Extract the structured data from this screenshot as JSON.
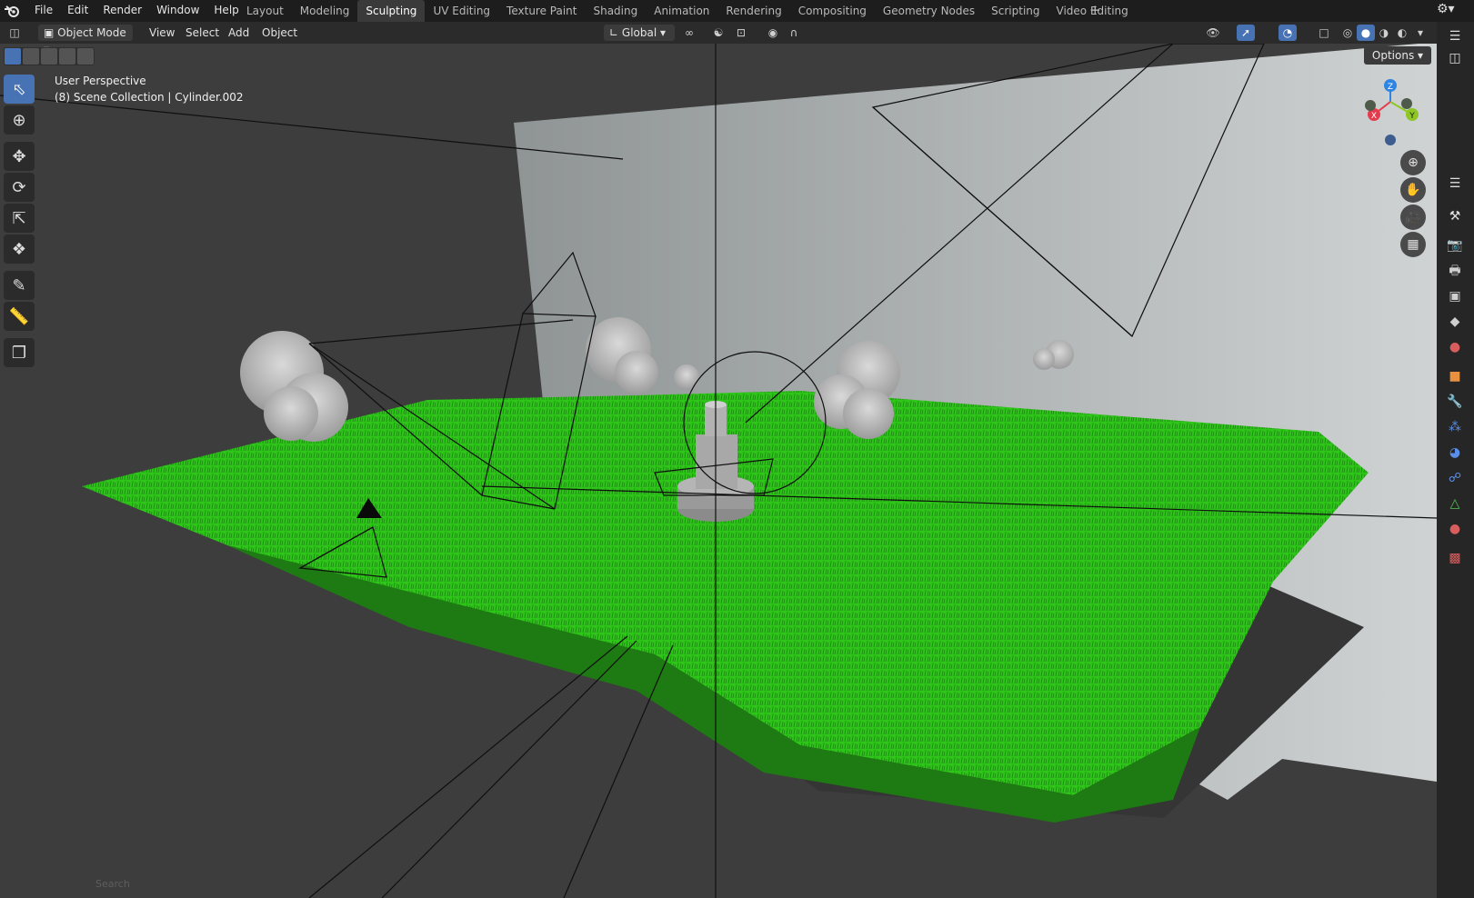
{
  "menubar": {
    "items": [
      "File",
      "Edit",
      "Render",
      "Window",
      "Help"
    ]
  },
  "workspaces": {
    "tabs": [
      "Layout",
      "Modeling",
      "Sculpting",
      "UV Editing",
      "Texture Paint",
      "Shading",
      "Animation",
      "Rendering",
      "Compositing",
      "Geometry Nodes",
      "Scripting",
      "Video Editing"
    ],
    "active": "Sculpting",
    "add_label": "+"
  },
  "viewport_header": {
    "mode": "Object Mode",
    "menus": [
      "View",
      "Select",
      "Add",
      "Object"
    ],
    "transform_orientation": "Global"
  },
  "viewport": {
    "perspective_label": "User Perspective",
    "collection_label": "(8) Scene Collection | Cylinder.002",
    "options_label": "Options",
    "search_placeholder": "Search"
  },
  "gizmo": {
    "x_label": "X",
    "y_label": "Y",
    "z_label": "Z"
  },
  "colors": {
    "accent": "#4772b3",
    "grass": "#2fc61a",
    "axis_x": "#e43b4d",
    "axis_y": "#8dc625",
    "axis_z": "#2e84e3"
  },
  "icons": {
    "toolbar": [
      "select-box-icon",
      "cursor-icon",
      "move-icon",
      "rotate-icon",
      "scale-icon",
      "transform-icon",
      "annotate-icon",
      "measure-icon",
      "add-cube-icon"
    ],
    "properties": [
      "tool-icon",
      "render-icon",
      "output-icon",
      "view-layer-icon",
      "scene-icon",
      "world-icon",
      "object-icon",
      "modifier-icon",
      "particles-icon",
      "physics-icon",
      "constraints-icon",
      "data-icon",
      "material-icon",
      "texture-icon"
    ]
  }
}
